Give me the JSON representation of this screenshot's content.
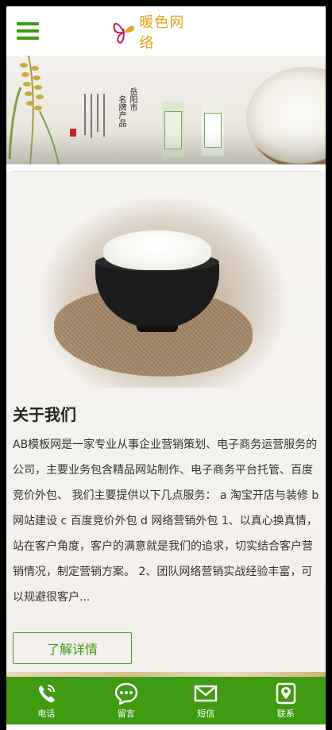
{
  "header": {
    "logo_text": "暖色网络",
    "menu_icon": "hamburger-menu-icon",
    "accent_color": "#3f9b12",
    "logo_color": "#e4a319"
  },
  "banner": {
    "calligraphy_left": "岳阳市",
    "calligraphy_right": "名牌产品"
  },
  "about": {
    "title": "关于我们",
    "text": "AB模板网是一家专业从事企业营销策划、电子商务运营服务的公司，主要业务包含精品网站制作、电子商务平台托管、百度竞价外包、 我们主要提供以下几点服务： a 淘宝开店与装修 b 网站建设 c 百度竞价外包 d 网络营销外包 1、以真心换真情，站在客户角度，客户的满意就是我们的追求，切实结合客户营销情况，制定营销方案。 2、团队网络营销实战经验丰富，可以规避很客户...",
    "more_label": "了解详情"
  },
  "bottom_nav": {
    "items": [
      {
        "label": "电话",
        "icon": "phone-icon"
      },
      {
        "label": "留言",
        "icon": "chat-bubble-icon"
      },
      {
        "label": "短信",
        "icon": "envelope-icon"
      },
      {
        "label": "联系",
        "icon": "map-pin-icon"
      }
    ]
  }
}
